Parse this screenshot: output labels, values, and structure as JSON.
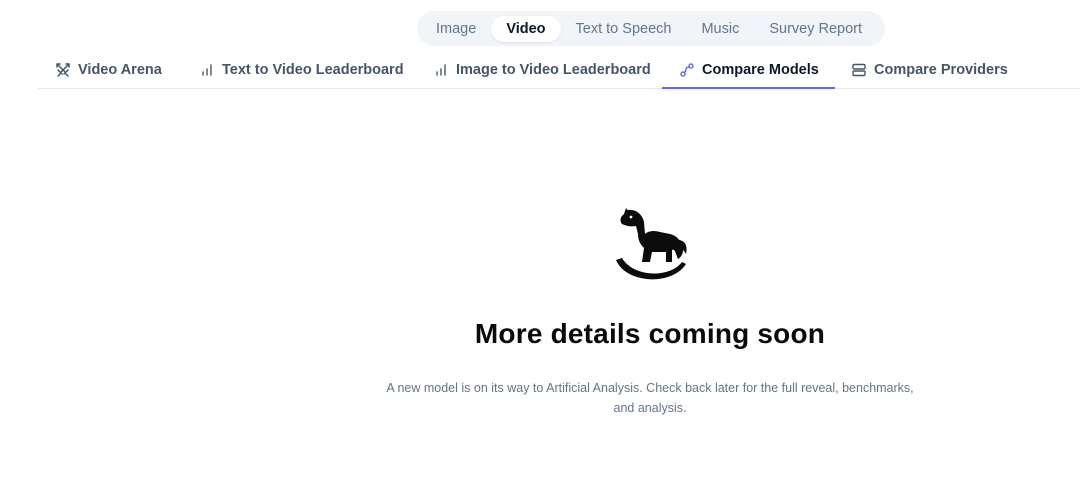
{
  "modality_switcher": {
    "items": [
      {
        "label": "Image",
        "active": false
      },
      {
        "label": "Video",
        "active": true
      },
      {
        "label": "Text to Speech",
        "active": false
      },
      {
        "label": "Music",
        "active": false
      },
      {
        "label": "Survey Report",
        "active": false
      }
    ]
  },
  "tabs": [
    {
      "label": "Video Arena",
      "icon": "swords-icon",
      "active": false
    },
    {
      "label": "Text to Video Leaderboard",
      "icon": "bar-chart-icon",
      "active": false
    },
    {
      "label": "Image to Video Leaderboard",
      "icon": "bar-chart-icon",
      "active": false
    },
    {
      "label": "Compare Models",
      "icon": "nodes-link-icon",
      "active": true
    },
    {
      "label": "Compare Providers",
      "icon": "server-icon",
      "active": false
    }
  ],
  "empty_state": {
    "icon": "rocking-horse-icon",
    "title": "More details coming soon",
    "description": "A new model is on its way to Artificial Analysis. Check back later for the full reveal, benchmarks, and analysis."
  },
  "colors": {
    "accent": "#6366f1",
    "switcher_bg": "#f1f4f9",
    "muted_text": "#64748b"
  }
}
